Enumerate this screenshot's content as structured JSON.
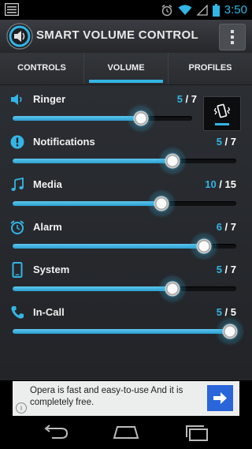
{
  "status_bar": {
    "time": "3:50",
    "icons": [
      "notification-menu-icon",
      "alarm-icon",
      "wifi-icon",
      "signal-icon",
      "battery-icon"
    ]
  },
  "app": {
    "title": "SMART VOLUME CONTROL",
    "overflow_icon": "overflow-menu-icon"
  },
  "tabs": [
    {
      "label": "CONTROLS",
      "active": false
    },
    {
      "label": "VOLUME",
      "active": true
    },
    {
      "label": "PROFILES",
      "active": false
    }
  ],
  "volumes": [
    {
      "label": "Ringer",
      "current": "5",
      "max": "7",
      "level": 0.7143,
      "icon": "speaker-icon"
    },
    {
      "label": "Notifications",
      "current": "5",
      "max": "7",
      "level": 0.7143,
      "icon": "exclamation-icon"
    },
    {
      "label": "Media",
      "current": "10",
      "max": "15",
      "level": 0.6667,
      "icon": "music-note-icon"
    },
    {
      "label": "Alarm",
      "current": "6",
      "max": "7",
      "level": 0.8571,
      "icon": "alarm-clock-icon"
    },
    {
      "label": "System",
      "current": "5",
      "max": "7",
      "level": 0.7143,
      "icon": "phone-icon"
    },
    {
      "label": "In-Call",
      "current": "5",
      "max": "5",
      "level": 1.0,
      "icon": "handset-icon"
    }
  ],
  "ringer_mode": {
    "icon": "vibrate-icon"
  },
  "ad": {
    "text": "Opera is fast and easy-to-use And it is completely free.",
    "info_label": "i",
    "cta_icon": "arrow-right-icon"
  },
  "nav": [
    "back-icon",
    "home-icon",
    "recents-icon"
  ],
  "colors": {
    "accent": "#33b5e5",
    "background": "#222428",
    "ad_button": "#2a66d9"
  }
}
